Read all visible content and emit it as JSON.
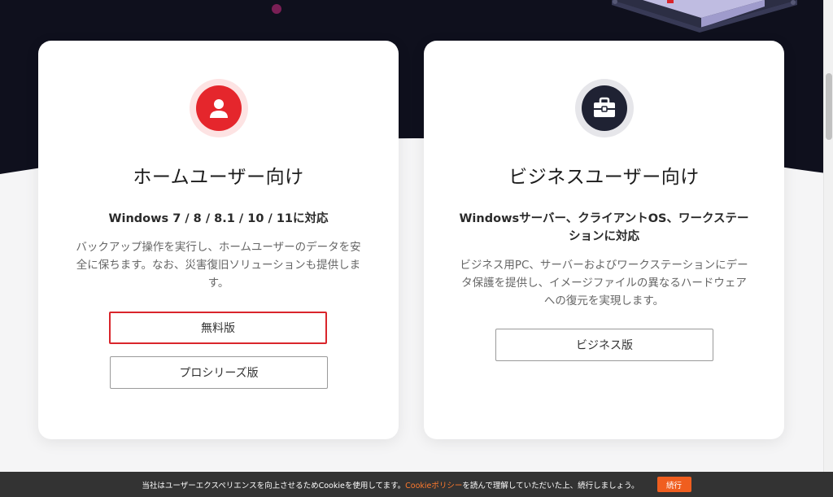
{
  "colors": {
    "hero_dark": "#0f101d",
    "accent_red": "#e5262c",
    "accent_orange": "#f05e1f",
    "icon_dark": "#1f2233"
  },
  "home_card": {
    "icon": "user-icon",
    "title": "ホームユーザー向け",
    "subtitle": "Windows 7 / 8 / 8.1 / 10 / 11に対応",
    "description": "バックアップ操作を実行し、ホームユーザーのデータを安全に保ちます。なお、災害復旧ソリューションも提供します。",
    "buttons": {
      "free": "無料版",
      "pro": "プロシリーズ版"
    }
  },
  "business_card": {
    "icon": "briefcase-icon",
    "title": "ビジネスユーザー向け",
    "subtitle": "Windowsサーバー、クライアントOS、ワークステーションに対応",
    "description": "ビジネス用PC、サーバーおよびワークステーションにデータ保護を提供し、イメージファイルの異なるハードウェアへの復元を実現します。",
    "buttons": {
      "business": "ビジネス版"
    }
  },
  "cookie_bar": {
    "text_before": "当社はユーザーエクスペリエンスを向上させるためCookieを使用してます。",
    "link": "Cookieポリシー",
    "text_after": "を読んで理解していただいた上、続行しましょう。",
    "button": "続行"
  }
}
